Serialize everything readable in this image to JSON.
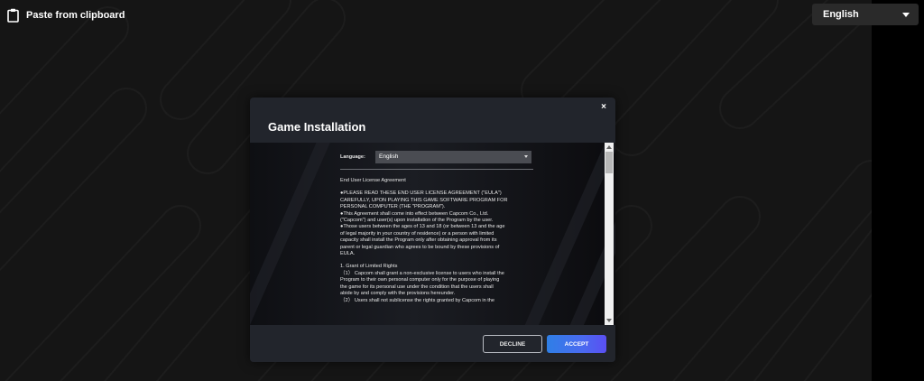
{
  "topbar": {
    "paste_label": "Paste from clipboard",
    "paste_icon": "clipboard-icon",
    "language_value": "English"
  },
  "modal": {
    "title": "Game Installation",
    "close_glyph": "×",
    "language_label": "Language:",
    "language_value": "English",
    "eula_lines": [
      "End User License Agreement",
      "",
      "●PLEASE READ THESE END USER LICENSE AGREEMENT (\"EULA\")",
      "CAREFULLY, UPON PLAYING THIS GAME SOFTWARE PROGRAM FOR",
      "PERSONAL COMPUTER (THE \"PROGRAM\").",
      "●This Agreement shall come into effect between Capcom Co., Ltd.",
      "(\"Capcom\") and user(s) upon installation of the Program by the user.",
      "●Those users between the ages of 13 and 18 (or between 13 and the age",
      "of legal majority in your country of residence) or a person with limited",
      "capacity shall install the Program only after obtaining approval from its",
      "parent or legal guardian who agrees to be bound by these provisions of",
      "EULA.",
      "",
      "1. Grant of Limited Rights",
      "（1） Capcom shall grant a non-exclusive license to users who install the",
      "Program to their own personal computer only for the purpose of playing",
      "the game for its personal use under the condition that the users shall",
      "abide by and comply with the provisions hereunder.",
      "（2） Users shall not sublicense the rights granted by Capcom in the"
    ],
    "decline_label": "DECLINE",
    "accept_label": "ACCEPT"
  },
  "colors": {
    "background": "#151515",
    "modal": "#22252c",
    "accent_start": "#2f7fe6",
    "accent_end": "#5a4ff2"
  }
}
